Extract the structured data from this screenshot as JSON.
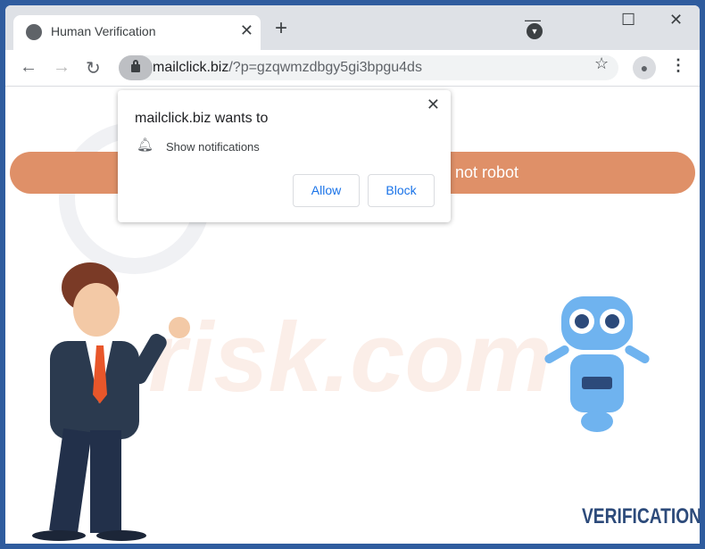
{
  "tab": {
    "title": "Human Verification",
    "icon": "globe-icon"
  },
  "toolbar": {
    "url_domain": "mailclick.biz",
    "url_path": "/?p=gzqwmzdbgy5gi3bpgu4ds"
  },
  "page": {
    "button_text": "not robot",
    "logo_text": "VERIFICATION"
  },
  "popup": {
    "title": "mailclick.biz wants to",
    "permission": "Show notifications",
    "allow": "Allow",
    "block": "Block"
  },
  "colors": {
    "frame": "#2f5c9e",
    "bar": "#df9068",
    "link": "#1a73e8"
  }
}
